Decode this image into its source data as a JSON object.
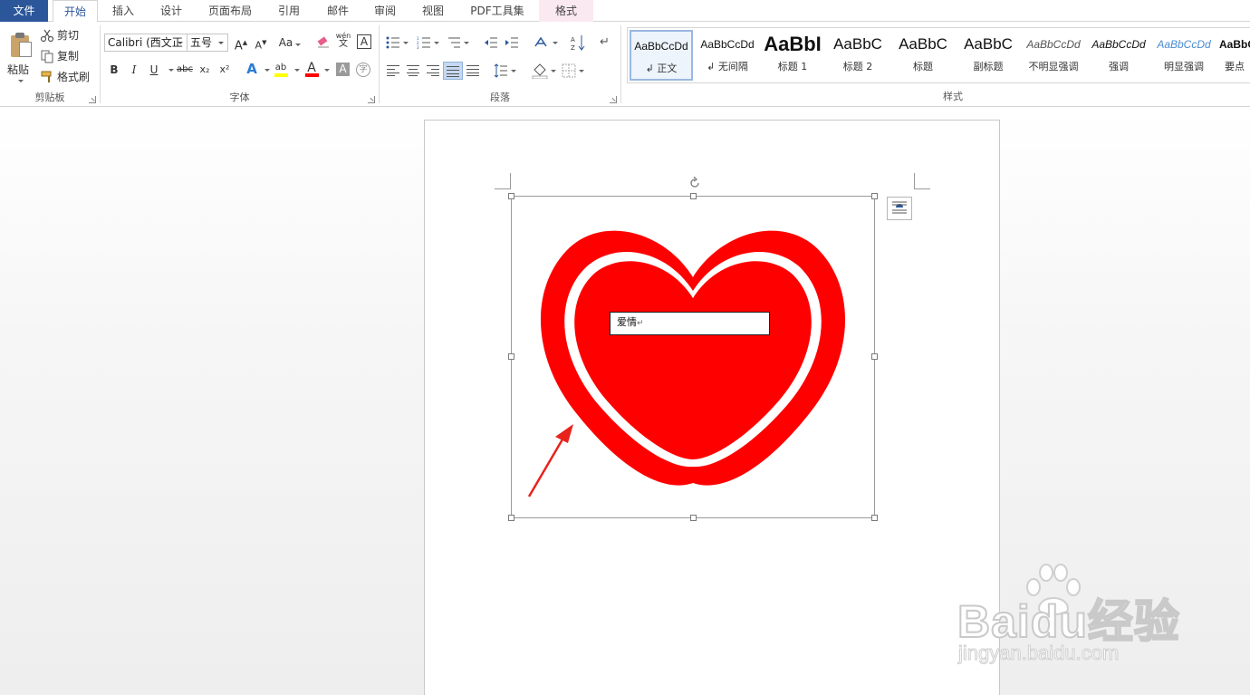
{
  "tabs": {
    "file": "文件",
    "items": [
      "开始",
      "插入",
      "设计",
      "页面布局",
      "引用",
      "邮件",
      "审阅",
      "视图",
      "PDF工具集"
    ],
    "context": "格式"
  },
  "clipboard": {
    "paste": "粘贴",
    "cut": "剪切",
    "copy": "复制",
    "format_painter": "格式刷",
    "label": "剪贴板"
  },
  "font": {
    "name": "Calibri (西文正",
    "size": "五号",
    "label": "字体",
    "grow": "A",
    "shrink": "A",
    "case": "Aa",
    "phonetic_top": "wén",
    "phonetic_bottom": "文",
    "border_char": "A",
    "bold": "B",
    "italic": "I",
    "underline": "U",
    "strike": "abc",
    "subscript": "x₂",
    "superscript": "x²",
    "effects": "A",
    "font_color": "A",
    "shading": "A",
    "enclose": "字",
    "highlight": "ab"
  },
  "paragraph": {
    "label": "段落"
  },
  "styles": {
    "label": "样式",
    "items": [
      {
        "preview": "AaBbCcDd",
        "name": "↲ 正文"
      },
      {
        "preview": "AaBbCcDd",
        "name": "↲ 无间隔"
      },
      {
        "preview": "AaBbI",
        "name": "标题 1"
      },
      {
        "preview": "AaBbC",
        "name": "标题 2"
      },
      {
        "preview": "AaBbC",
        "name": "标题"
      },
      {
        "preview": "AaBbC",
        "name": "副标题"
      },
      {
        "preview": "AaBbCcDd",
        "name": "不明显强调"
      },
      {
        "preview": "AaBbCcDd",
        "name": "强调"
      },
      {
        "preview": "AaBbCcDd",
        "name": "明显强调"
      },
      {
        "preview": "AaBbC",
        "name": "要点"
      }
    ]
  },
  "document": {
    "textbox_text": "爱情",
    "paragraph_mark": "↵"
  },
  "colors": {
    "accent": "#2b579a",
    "heart": "#ff0000",
    "arrow": "#e8231c",
    "highlight_bar": "#ffff00",
    "font_color_bar": "#ff0000"
  },
  "watermark": {
    "brand": "Baidu经验",
    "url": "jingyan.baidu.com"
  }
}
